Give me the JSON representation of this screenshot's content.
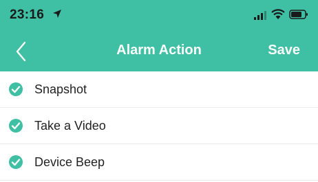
{
  "status_bar": {
    "time": "23:16",
    "location_icon": "location-arrow-icon",
    "signal_icon": "cellular-signal-icon",
    "wifi_icon": "wifi-icon",
    "battery_icon": "battery-icon"
  },
  "nav": {
    "back_icon": "chevron-left-icon",
    "title": "Alarm Action",
    "save_label": "Save"
  },
  "colors": {
    "accent": "#3fbfa3",
    "check": "#3fbfa3",
    "text": "#222222",
    "header_text": "#ffffff"
  },
  "actions": [
    {
      "label": "Snapshot",
      "checked": true,
      "icon": "check-circle-icon"
    },
    {
      "label": "Take a Video",
      "checked": true,
      "icon": "check-circle-icon"
    },
    {
      "label": "Device Beep",
      "checked": true,
      "icon": "check-circle-icon"
    }
  ]
}
